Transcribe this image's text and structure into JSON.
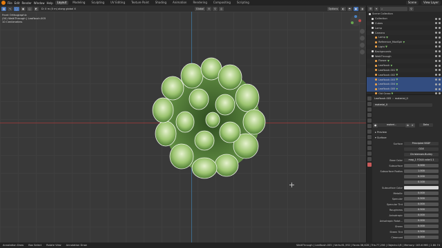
{
  "menubar": {
    "items": [
      "File",
      "Edit",
      "Render",
      "Window",
      "Help"
    ],
    "workspaces": [
      "Layout",
      "Modeling",
      "Sculpting",
      "UV Editing",
      "Texture Paint",
      "Shading",
      "Animation",
      "Rendering",
      "Compositing",
      "Scripting"
    ],
    "scene": "Scene",
    "view_layer": "View Layer"
  },
  "viewport": {
    "header_hint": "D: 0 m (0 m) along global X",
    "orientation": "Global",
    "options": "Options",
    "overlay_title": "Front Orthographic",
    "overlay_path": "(50) WalkThrough | Leafbush.005",
    "overlay_scale": "10 Centimeters"
  },
  "outliner": {
    "header": "Scene Collection",
    "rows": [
      {
        "label": "Collection",
        "selected": false,
        "object": false
      },
      {
        "label": "Cubes",
        "selected": false,
        "object": false
      },
      {
        "label": "Lamp",
        "selected": false,
        "object": false
      },
      {
        "label": "Camera",
        "selected": false,
        "object": false
      },
      {
        "label": "Lamp",
        "selected": false,
        "object": true
      },
      {
        "label": "Reference_ModSph",
        "selected": false,
        "object": true
      },
      {
        "label": "Light",
        "selected": false,
        "object": true
      },
      {
        "label": "Backgrounds",
        "selected": false,
        "object": false
      },
      {
        "label": "WalkThrough",
        "selected": false,
        "object": false
      },
      {
        "label": "Flower",
        "selected": false,
        "object": true
      },
      {
        "label": "Leafbush",
        "selected": false,
        "object": true
      },
      {
        "label": "Leafbush.001",
        "selected": false,
        "object": true
      },
      {
        "label": "Leafbush.002",
        "selected": false,
        "object": true
      },
      {
        "label": "Leafbush.003",
        "selected": true,
        "object": true
      },
      {
        "label": "Leafbush.004",
        "selected": true,
        "object": true
      },
      {
        "label": "Leafbush.005",
        "selected": true,
        "object": true
      },
      {
        "label": "Old Grass",
        "selected": false,
        "object": true
      }
    ]
  },
  "properties": {
    "object_name": "Leafbush.005",
    "material_name": "material_0",
    "slot": "material_0",
    "datablock": "materi...",
    "data_label": "Data",
    "preview": "Preview",
    "surface_header": "Surface",
    "fields": [
      {
        "label": "Surface",
        "value": "Principled BSDF",
        "kind": "dark"
      },
      {
        "label": "",
        "value": "GGX",
        "kind": "dark"
      },
      {
        "label": "",
        "value": "Christensen-Burley",
        "kind": "dark"
      },
      {
        "label": "Base Color",
        "value": "map_1 FOLIA color1.1",
        "kind": "dark"
      },
      {
        "label": "Subsurface",
        "value": "0.000",
        "kind": "plain"
      },
      {
        "label": "Subsurface Radius",
        "value": "1.000",
        "kind": "plain"
      },
      {
        "label": "",
        "value": "0.200",
        "kind": "plain"
      },
      {
        "label": "",
        "value": "0.100",
        "kind": "plain"
      },
      {
        "label": "Subsurface Color",
        "value": "",
        "kind": "white"
      },
      {
        "label": "Metallic",
        "value": "0.000",
        "kind": "plain"
      },
      {
        "label": "Specular",
        "value": "0.500",
        "kind": "bar",
        "level": 0.5
      },
      {
        "label": "Specular Tint",
        "value": "0.000",
        "kind": "plain"
      },
      {
        "label": "Roughness",
        "value": "0.500",
        "kind": "bar",
        "level": 0.5
      },
      {
        "label": "Anisotropic",
        "value": "0.000",
        "kind": "plain"
      },
      {
        "label": "Anisotropic Rotat...",
        "value": "0.000",
        "kind": "plain"
      },
      {
        "label": "Sheen",
        "value": "0.000",
        "kind": "plain"
      },
      {
        "label": "Sheen Tint",
        "value": "0.500",
        "kind": "bar",
        "level": 0.5
      },
      {
        "label": "Clearcoat",
        "value": "0.000",
        "kind": "plain"
      }
    ]
  },
  "statusbar": {
    "items": [
      "Annotation Draw",
      "Box Select",
      "Rotate View",
      "Annotation Draw"
    ],
    "stats": "WalkThrough | Leafbush.005 | Verts:81,592 | Faces:38,628 | Tris:77,256 | Objects:1/6 | Memory: 163.6 MiB | 2.80.74"
  },
  "colors": {
    "accent": "#4772b3",
    "x_axis": "#8a3a3a",
    "y_axis": "#3f6c8c",
    "leaf": "#7fb35a"
  }
}
